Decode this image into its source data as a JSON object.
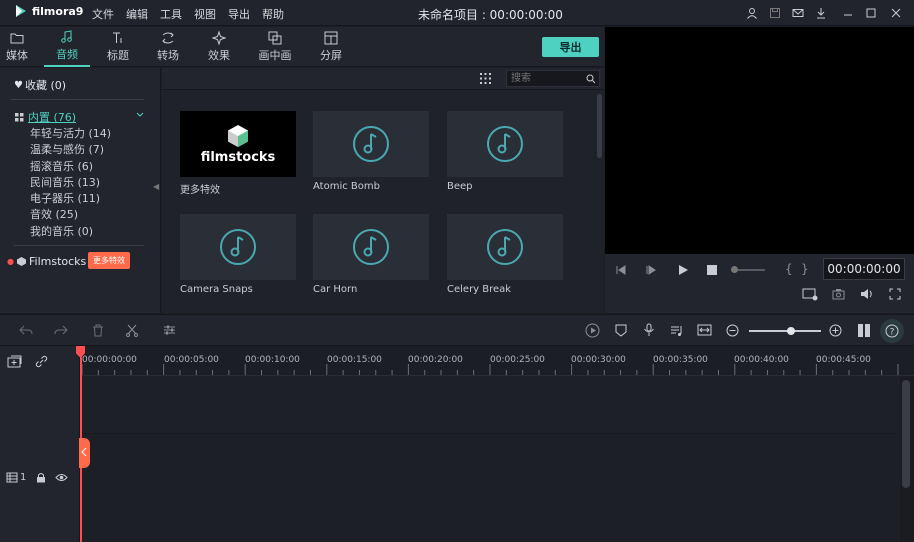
{
  "app": {
    "name": "filmora9",
    "title": "未命名项目 : 00:00:00:00"
  },
  "menu": [
    "文件",
    "编辑",
    "工具",
    "视图",
    "导出",
    "帮助"
  ],
  "tabs": [
    {
      "label": "媒体",
      "icon": "folder-icon"
    },
    {
      "label": "音频",
      "icon": "music-note-icon"
    },
    {
      "label": "标题",
      "icon": "title-text-icon"
    },
    {
      "label": "转场",
      "icon": "transition-icon"
    },
    {
      "label": "效果",
      "icon": "effects-icon"
    },
    {
      "label": "画中画",
      "icon": "pip-icon"
    },
    {
      "label": "分屏",
      "icon": "split-screen-icon"
    }
  ],
  "export_label": "导出",
  "sidebar": {
    "favorites": "收藏 (0)",
    "builtin": "内置 (76)",
    "items": [
      "年轻与活力 (14)",
      "温柔与感伤 (7)",
      "摇滚音乐 (6)",
      "民间音乐 (13)",
      "电子器乐 (11)",
      "音效 (25)",
      "我的音乐 (0)"
    ],
    "filmstocks": "Filmstocks",
    "more_badge": "更多特效"
  },
  "search": {
    "placeholder": "搜索"
  },
  "media_items": [
    {
      "label": "更多特效",
      "type": "filmstocks",
      "logo_text": "filmstocks"
    },
    {
      "label": "Atomic Bomb",
      "type": "audio"
    },
    {
      "label": "Beep",
      "type": "audio"
    },
    {
      "label": "Camera Snaps",
      "type": "audio"
    },
    {
      "label": "Car Horn",
      "type": "audio"
    },
    {
      "label": "Celery Break",
      "type": "audio"
    }
  ],
  "preview": {
    "timecode": "00:00:00:00",
    "brace_left": "{",
    "brace_right": "}"
  },
  "ruler": [
    "00:00:00:00",
    "00:00:05:00",
    "00:00:10:00",
    "00:00:15:00",
    "00:00:20:00",
    "00:00:25:00",
    "00:00:30:00",
    "00:00:35:00",
    "00:00:40:00",
    "00:00:45:00"
  ],
  "tracks": {
    "video_number": "1"
  },
  "colors": {
    "accent": "#4fd1c1",
    "playhead": "#ff4e4e",
    "badge": "#ff6b4a"
  }
}
